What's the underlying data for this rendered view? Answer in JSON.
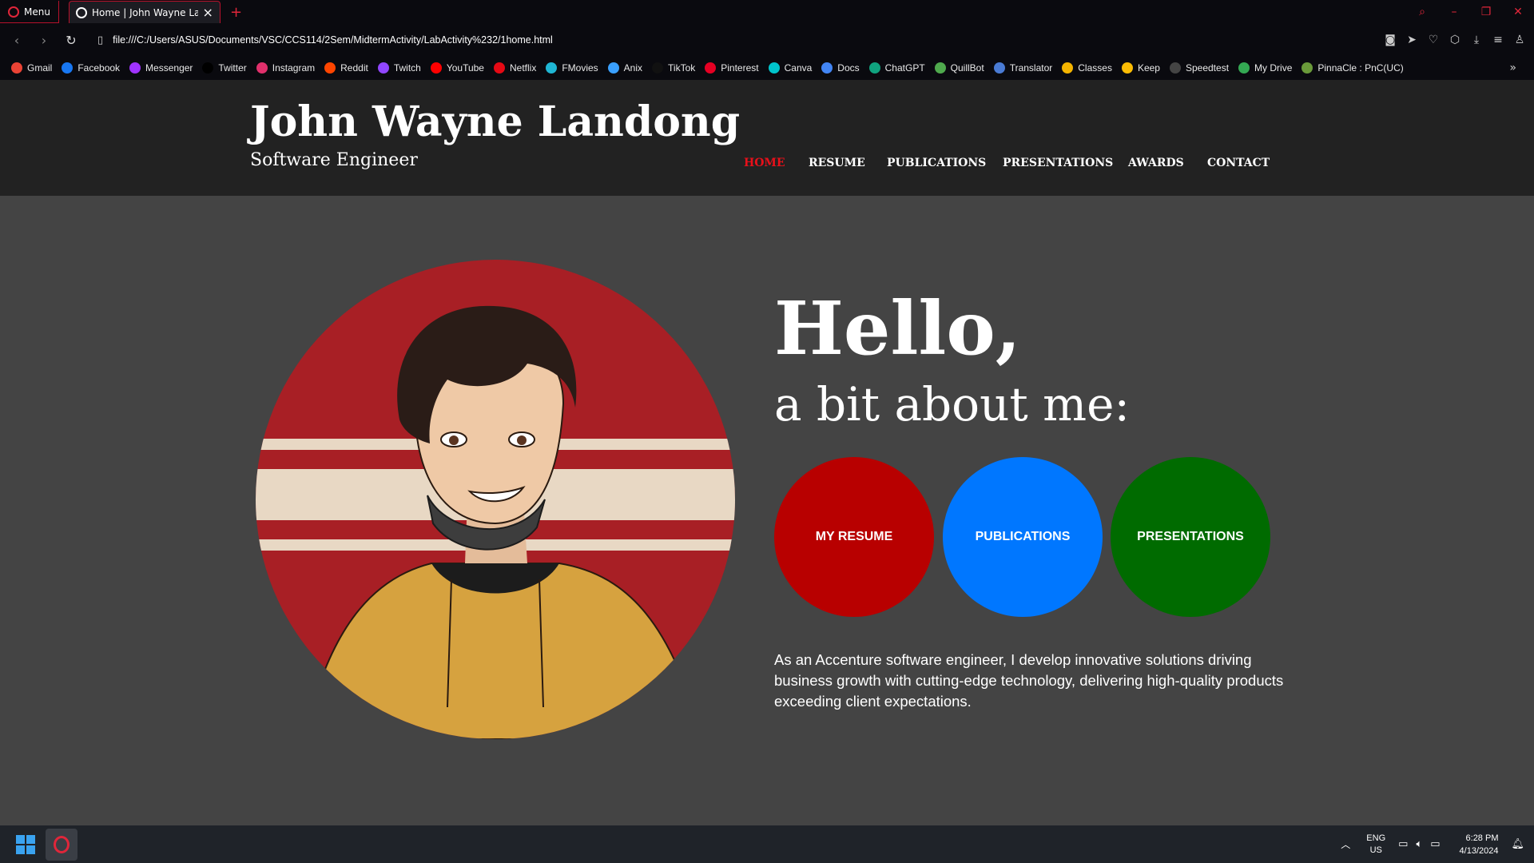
{
  "browser": {
    "menu_label": "Menu",
    "tab_title": "Home | John Wayne Lando",
    "url": "file:///C:/Users/ASUS/Documents/VSC/CCS114/2Sem/MidtermActivity/LabActivity%232/1home.html"
  },
  "bookmarks": [
    {
      "label": "Gmail",
      "icon": "gmail-icon",
      "color": "#ea4335"
    },
    {
      "label": "Facebook",
      "icon": "facebook-icon",
      "color": "#1877f2"
    },
    {
      "label": "Messenger",
      "icon": "messenger-icon",
      "color": "#a033ff"
    },
    {
      "label": "Twitter",
      "icon": "x-icon",
      "color": "#000000"
    },
    {
      "label": "Instagram",
      "icon": "instagram-icon",
      "color": "#e1306c"
    },
    {
      "label": "Reddit",
      "icon": "reddit-icon",
      "color": "#ff4500"
    },
    {
      "label": "Twitch",
      "icon": "twitch-icon",
      "color": "#9146ff"
    },
    {
      "label": "YouTube",
      "icon": "youtube-icon",
      "color": "#ff0000"
    },
    {
      "label": "Netflix",
      "icon": "netflix-icon",
      "color": "#e50914"
    },
    {
      "label": "FMovies",
      "icon": "fmovies-icon",
      "color": "#1fb6d4"
    },
    {
      "label": "Anix",
      "icon": "anix-icon",
      "color": "#3aa0ff"
    },
    {
      "label": "TikTok",
      "icon": "tiktok-icon",
      "color": "#111111"
    },
    {
      "label": "Pinterest",
      "icon": "pinterest-icon",
      "color": "#e60023"
    },
    {
      "label": "Canva",
      "icon": "canva-icon",
      "color": "#00c4cc"
    },
    {
      "label": "Docs",
      "icon": "docs-icon",
      "color": "#4285f4"
    },
    {
      "label": "ChatGPT",
      "icon": "chatgpt-icon",
      "color": "#10a37f"
    },
    {
      "label": "QuillBot",
      "icon": "quillbot-icon",
      "color": "#4fa94d"
    },
    {
      "label": "Translator",
      "icon": "translator-icon",
      "color": "#4a7bd4"
    },
    {
      "label": "Classes",
      "icon": "classes-icon",
      "color": "#f4b400"
    },
    {
      "label": "Keep",
      "icon": "keep-icon",
      "color": "#fbbc04"
    },
    {
      "label": "Speedtest",
      "icon": "speedtest-icon",
      "color": "#444444"
    },
    {
      "label": "My Drive",
      "icon": "drive-icon",
      "color": "#34a853"
    },
    {
      "label": "PinnaCle : PnC(UC)",
      "icon": "pinnacle-icon",
      "color": "#6a9a3a"
    }
  ],
  "site": {
    "name": "John Wayne Landong",
    "subtitle": "Software Engineer",
    "nav": [
      {
        "label": "HOME",
        "active": true
      },
      {
        "label": "RESUME",
        "active": false
      },
      {
        "label": "PUBLICATIONS",
        "active": false
      },
      {
        "label": "PRESENTATIONS",
        "active": false
      },
      {
        "label": "AWARDS",
        "active": false
      },
      {
        "label": "CONTACT",
        "active": false
      }
    ],
    "accent": "#e8101a"
  },
  "hero": {
    "hello": "Hello,",
    "about": "a bit about me:",
    "buttons": [
      {
        "label": "MY RESUME",
        "color": "#b80000"
      },
      {
        "label": "PUBLICATIONS",
        "color": "#0077ff"
      },
      {
        "label": "PRESENTATIONS",
        "color": "#006b00"
      }
    ],
    "bio": "As an Accenture software engineer, I develop innovative solutions driving business growth with cutting-edge technology, delivering high-quality products exceeding client expectations."
  },
  "taskbar": {
    "lang_line1": "ENG",
    "lang_line2": "US",
    "time": "6:28 PM",
    "date": "4/13/2024"
  }
}
